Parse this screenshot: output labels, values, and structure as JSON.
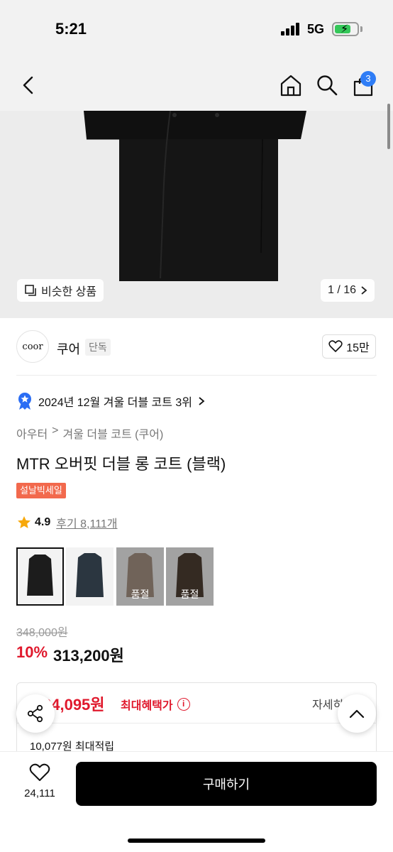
{
  "status_bar": {
    "time": "5:21",
    "network": "5G"
  },
  "nav": {
    "back_icon": "chevron-left-icon",
    "home_icon": "home-icon",
    "search_icon": "search-icon",
    "cart_icon": "shopping-bag-icon",
    "cart_count": "3"
  },
  "gallery": {
    "similar_label": "비슷한 상품",
    "page_indicator": "1 / 16"
  },
  "brand": {
    "logo_text": "coor",
    "name": "쿠어",
    "tag": "단독",
    "likes": "15만"
  },
  "ranking": {
    "text": "2024년 12월 겨울 더블 코트 3위"
  },
  "breadcrumb": {
    "level1": "아우터",
    "level2": "겨울 더블 코트 (쿠어)"
  },
  "product": {
    "title": "MTR 오버핏 더블 롱 코트 (블랙)",
    "sale_badge": "설날빅세일",
    "rating": "4.9",
    "review_text": "후기 8,111개"
  },
  "swatches": [
    {
      "color_name": "black",
      "color": "#1c1c1c",
      "soldout": ""
    },
    {
      "color_name": "navy",
      "color": "#2b3640",
      "soldout": ""
    },
    {
      "color_name": "beige",
      "color": "#a69383",
      "soldout": "품절"
    },
    {
      "color_name": "brown",
      "color": "#4d3e33",
      "soldout": "품절"
    }
  ],
  "price": {
    "original": "348,000원",
    "discount": "10%",
    "sale": "313,200원"
  },
  "benefit": {
    "amount": "24,095원",
    "label": "최대혜택가",
    "detail_link": "자세히",
    "points": "10,077원 최대적립"
  },
  "bottom": {
    "wish_count": "24,111",
    "buy_label": "구매하기"
  },
  "colors": {
    "accent_red": "#e0192d",
    "badge_blue": "#2f7df6",
    "sale_badge": "#f2694d"
  }
}
